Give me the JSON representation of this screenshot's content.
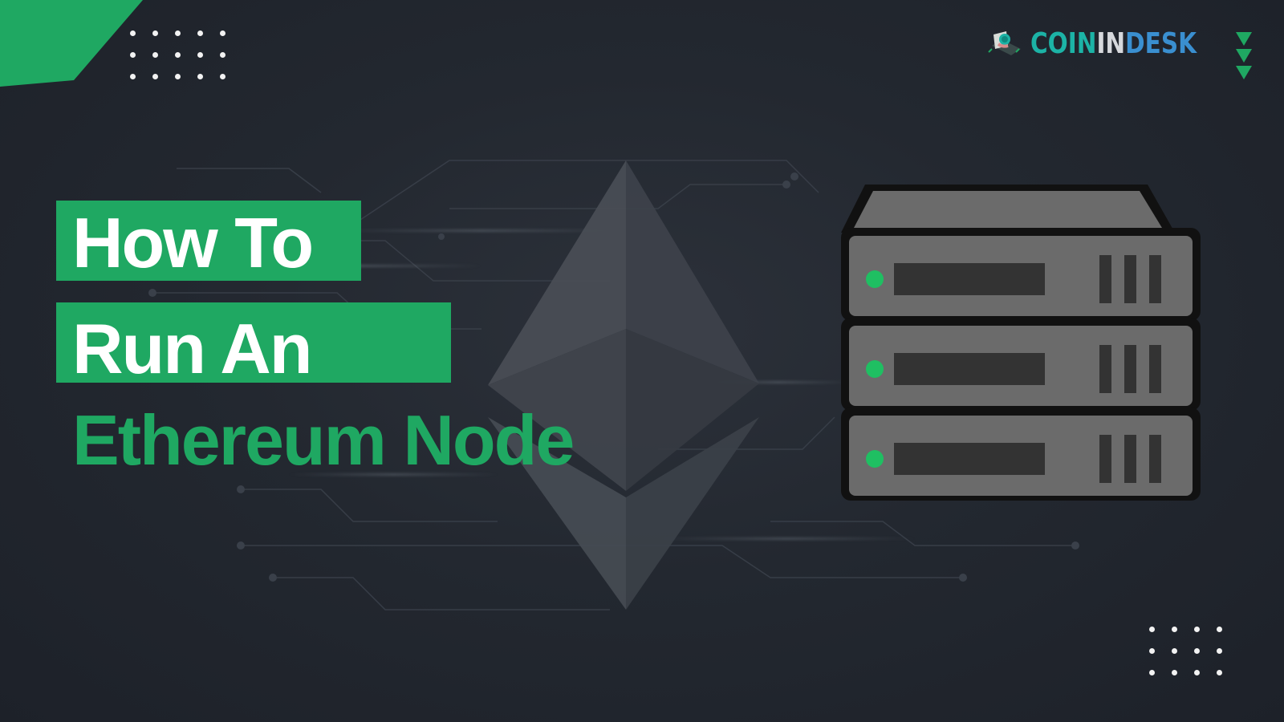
{
  "title": {
    "line1": "How To",
    "line2": "Run An",
    "line3": "Ethereum Node"
  },
  "brand": {
    "logo_parts": [
      "COIN",
      "IN",
      "DESK"
    ],
    "logo_colors": [
      "#1cb3a6",
      "#d6d8dc",
      "#3a8fd0"
    ],
    "logo_icon": "laptop-coin-icon"
  },
  "colors": {
    "accent_green": "#1fa862",
    "background": "#1e222b",
    "server_gray": "#6b6b6b",
    "server_dark": "#333333",
    "led_green": "#1fbf62"
  },
  "icons": {
    "chevrons": "triple-chevron-down-icon",
    "ethereum": "ethereum-logo-icon",
    "server": "server-rack-icon"
  },
  "server_units": 3
}
